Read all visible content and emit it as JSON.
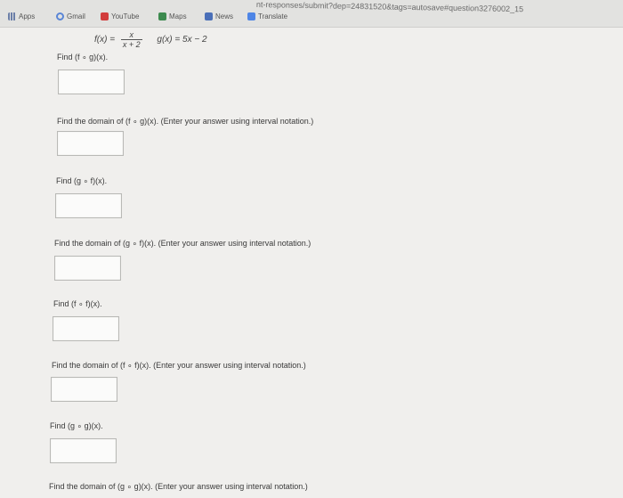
{
  "browser": {
    "url": "nt-responses/submit?dep=24831520&tags=autosave#question3276002_15",
    "bookmarks": [
      {
        "label": "Apps",
        "icon": "apps-grid-icon",
        "color": "#6b7fa8"
      },
      {
        "label": "Gmail",
        "icon": "google-icon",
        "color": "#5a86d6"
      },
      {
        "label": "YouTube",
        "icon": "youtube-icon",
        "color": "#d23c3c"
      },
      {
        "label": "Maps",
        "icon": "maps-icon",
        "color": "#3c8a4e"
      },
      {
        "label": "News",
        "icon": "news-icon",
        "color": "#4a6fb8"
      },
      {
        "label": "Translate",
        "icon": "translate-icon",
        "color": "#4f86e6"
      }
    ]
  },
  "problem": {
    "f_lhs": "f(x) =",
    "f_num": "x",
    "f_den": "x + 2",
    "g_def": "g(x) = 5x − 2"
  },
  "questions": [
    {
      "text": "Find (f ∘ g)(x).",
      "answer": ""
    },
    {
      "text": "Find the domain of (f ∘ g)(x). (Enter your answer using interval notation.)",
      "answer": ""
    },
    {
      "text": "Find (g ∘ f)(x).",
      "answer": ""
    },
    {
      "text": "Find the domain of (g ∘ f)(x). (Enter your answer using interval notation.)",
      "answer": ""
    },
    {
      "text": "Find (f ∘ f)(x).",
      "answer": ""
    },
    {
      "text": "Find the domain of (f ∘ f)(x). (Enter your answer using interval notation.)",
      "answer": ""
    },
    {
      "text": "Find (g ∘ g)(x).",
      "answer": ""
    },
    {
      "text": "Find the domain of (g ∘ g)(x). (Enter your answer using interval notation.)",
      "answer": ""
    }
  ]
}
